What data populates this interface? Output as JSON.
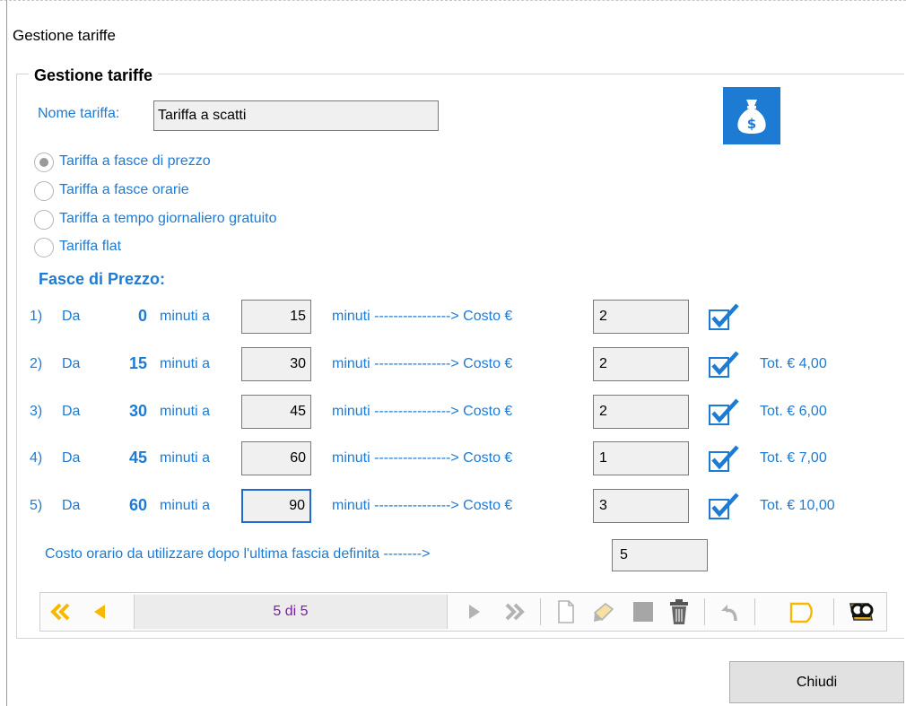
{
  "window": {
    "title": "Gestione tariffe"
  },
  "group": {
    "legend": "Gestione tariffe"
  },
  "tariff_name": {
    "label": "Nome tariffa:",
    "value": "Tariffa a scatti"
  },
  "tariff_types": [
    {
      "label": "Tariffa a fasce di prezzo",
      "selected": true
    },
    {
      "label": "Tariffa a fasce orarie",
      "selected": false
    },
    {
      "label": "Tariffa a tempo giornaliero gratuito",
      "selected": false
    },
    {
      "label": "Tariffa flat",
      "selected": false
    }
  ],
  "bands_section": {
    "title": "Fasce di Prezzo:",
    "da_label": "Da",
    "minutes_to_label": "minuti a",
    "arrow_label": "minuti ----------------> Costo €",
    "bands": [
      {
        "index": "1)",
        "from": "0",
        "to": "15",
        "cost": "2",
        "enabled": true,
        "total": ""
      },
      {
        "index": "2)",
        "from": "15",
        "to": "30",
        "cost": "2",
        "enabled": true,
        "total": "Tot. € 4,00"
      },
      {
        "index": "3)",
        "from": "30",
        "to": "45",
        "cost": "2",
        "enabled": true,
        "total": "Tot. € 6,00"
      },
      {
        "index": "4)",
        "from": "45",
        "to": "60",
        "cost": "1",
        "enabled": true,
        "total": "Tot. € 7,00"
      },
      {
        "index": "5)",
        "from": "60",
        "to": "90",
        "cost": "3",
        "enabled": true,
        "total": "Tot. € 10,00"
      }
    ]
  },
  "after_last": {
    "label": "Costo orario da utilizzare dopo l'ultima fascia definita -------->",
    "value": "5"
  },
  "navigator": {
    "position": "5 di 5",
    "icons": [
      "first-record-icon",
      "previous-record-icon",
      "next-record-icon",
      "last-record-icon",
      "new-record-icon",
      "edit-record-icon",
      "save-record-icon",
      "delete-record-icon",
      "undo-icon",
      "refresh-icon",
      "search-icon"
    ]
  },
  "buttons": {
    "close": "Chiudi"
  },
  "colors": {
    "accent": "#1e7bd3",
    "nav_accent": "#f7b800",
    "position_text": "#7a1fa2"
  }
}
